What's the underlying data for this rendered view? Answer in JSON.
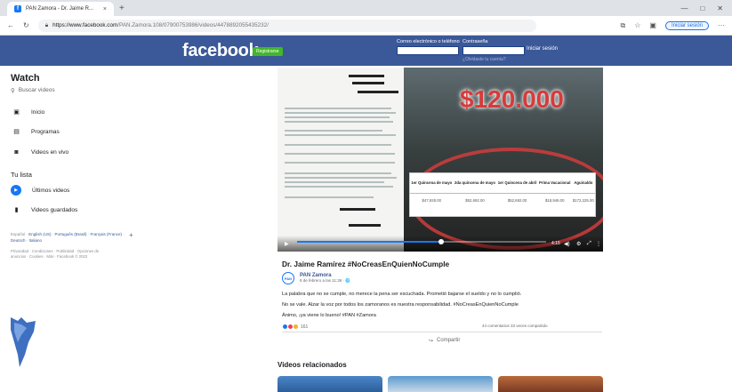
{
  "browser": {
    "tab_title": "PAN Zamora - Dr. Jaime R...",
    "tab_close": "×",
    "new_tab": "+",
    "url_host": "https://www.facebook.com",
    "url_path": "/PAN.Zamora.108/07900753986/videos/4478892055435232/",
    "signin_label": "Iniciar sesión",
    "win_controls": [
      "—",
      "□",
      "✕"
    ]
  },
  "fb_header": {
    "logo": "facebook",
    "register": "Registrarse",
    "email_label": "Correo electrónico o teléfono",
    "password_label": "Contraseña",
    "login_button": "Iniciar sesión",
    "forgot": "¿Olvidaste tu cuenta?"
  },
  "sidebar": {
    "heading": "Watch",
    "search_placeholder": "Buscar videos",
    "items": [
      {
        "label": "Inicio",
        "icon": "tv-icon"
      },
      {
        "label": "Programas",
        "icon": "programs-icon"
      },
      {
        "label": "Videos en vivo",
        "icon": "live-icon"
      }
    ],
    "list_heading": "Tu lista",
    "list_items": [
      {
        "label": "Últimos videos",
        "icon": "play-icon"
      },
      {
        "label": "Videos guardados",
        "icon": "bookmark-icon"
      }
    ],
    "languages": [
      "Español",
      "English (US)",
      "Português (Brasil)",
      "Français (France)",
      "Deutsch",
      "Italiano"
    ],
    "add_language": "+",
    "footer": "Privacidad · Condiciones · Publicidad · Opciones de anuncios · Cookies · Más · Facebook © 2022"
  },
  "video": {
    "price_overlay": "$120.000",
    "table_headers": [
      "1er Quincena de mayo",
      "2da quincena de mayo",
      "1er Quincena de abril",
      "Prima Vacacional",
      "Aguinaldo"
    ],
    "table_values": [
      "$47,928.00",
      "$52,692.00",
      "$52,692.00",
      "$18,946.00",
      "$172,225.00"
    ],
    "progress": 0.58,
    "time": "4:15",
    "controls": [
      "▶",
      "◀)",
      "⚙",
      "⤢",
      "⋮"
    ]
  },
  "post": {
    "title": "Dr. Jaime Ramírez #NoCreasEnQuienNoCumple",
    "author": "PAN Zamora",
    "author_initial": "PAN",
    "meta": "8 de febrero a las 11:36 · 🌐",
    "lines": [
      "La palabra que no se cumple, no merece la pena ser escuchada. Prometió bajarse el sueldo y no lo cumplió.",
      "No se vale. Alzar la voz por todos los zamoranos es nuestra responsabilidad. #NoCreasEnQuienNoCumple",
      "Ánimo, ¡ya viene lo bueno! #PAN #Zamora"
    ],
    "reaction_count": "161",
    "counts": "44 comentarios  33 veces compartido",
    "share": "Compartir",
    "related_heading": "Videos relacionados"
  },
  "colors": {
    "fb_blue": "#3b5998",
    "accent": "#1877f2",
    "price_red": "#d63b3b"
  }
}
